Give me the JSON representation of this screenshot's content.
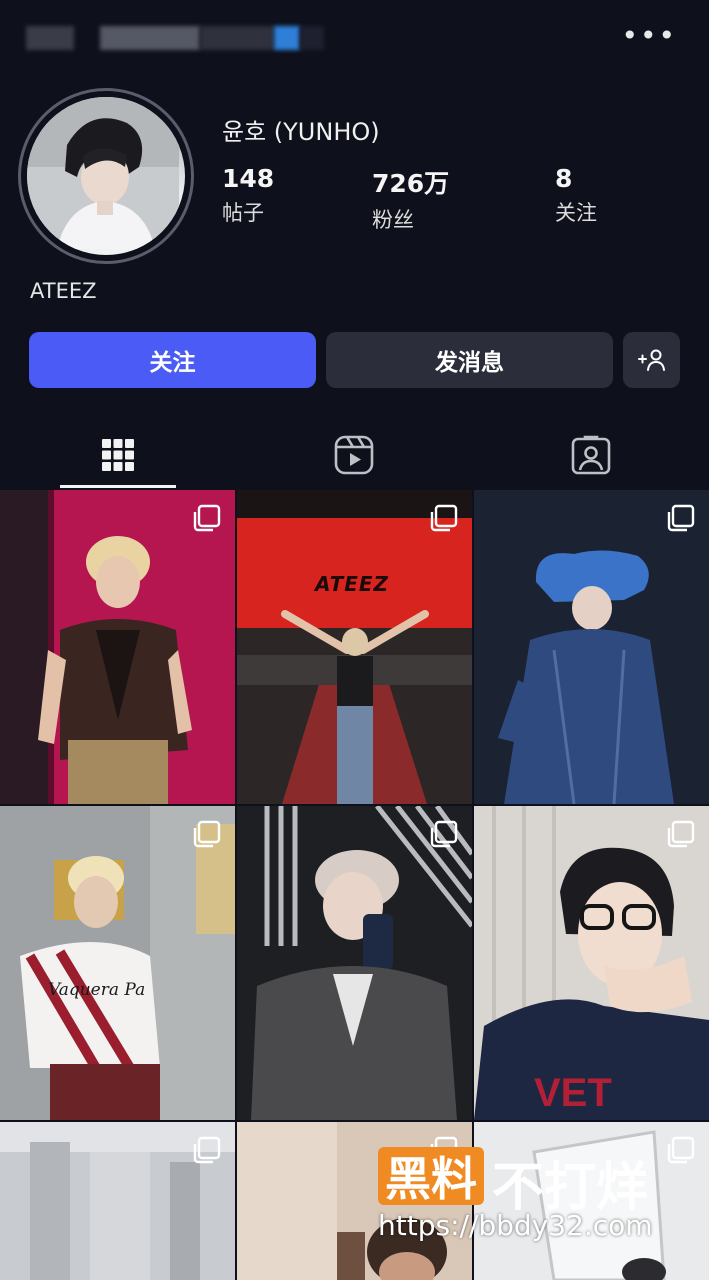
{
  "header": {
    "more_label": "•••"
  },
  "profile": {
    "display_name": "윤호 (YUNHO)",
    "bio": "ATEEZ",
    "stats": [
      {
        "value": "148",
        "label": "帖子"
      },
      {
        "value": "726万",
        "label": "粉丝"
      },
      {
        "value": "8",
        "label": "关注"
      }
    ]
  },
  "actions": {
    "follow_label": "关注",
    "message_label": "发消息",
    "add_icon": "person-add-icon"
  },
  "tabs": [
    {
      "name": "grid",
      "icon": "grid-icon",
      "active": true
    },
    {
      "name": "reels",
      "icon": "reels-icon",
      "active": false
    },
    {
      "name": "tagged",
      "icon": "tagged-person-icon",
      "active": false
    }
  ],
  "posts": [
    {
      "id": 1,
      "multi": true,
      "caption_text": ""
    },
    {
      "id": 2,
      "multi": true,
      "caption_text": "ATEEZ"
    },
    {
      "id": 3,
      "multi": true,
      "caption_text": ""
    },
    {
      "id": 4,
      "multi": true,
      "caption_text": "Vaquera Pa"
    },
    {
      "id": 5,
      "multi": true,
      "caption_text": ""
    },
    {
      "id": 6,
      "multi": true,
      "caption_text": ""
    },
    {
      "id": 7,
      "multi": true,
      "caption_text": ""
    },
    {
      "id": 8,
      "multi": true,
      "caption_text": ""
    },
    {
      "id": 9,
      "multi": true,
      "caption_text": ""
    }
  ],
  "watermark": {
    "box_text": "黑料",
    "text": "不打烊",
    "url": "https://bbdy32.com"
  },
  "colors": {
    "background": "#0e101b",
    "accent": "#4a5cf5",
    "secondary_button": "#2b2e3a",
    "watermark_orange": "#f08a22"
  }
}
